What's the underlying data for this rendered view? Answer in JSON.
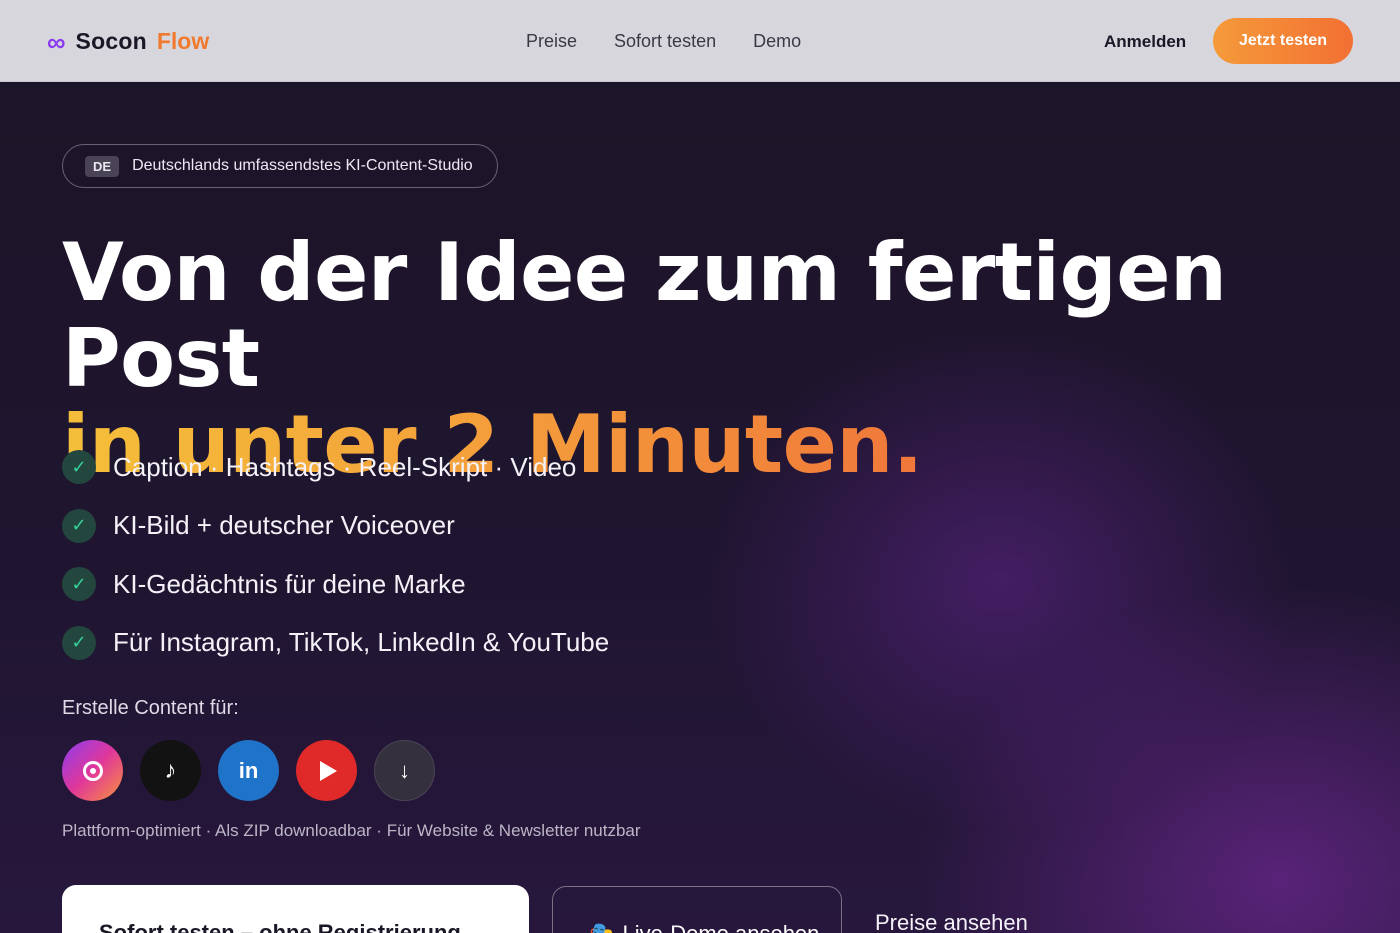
{
  "header": {
    "logo_mark": "∞",
    "logo_part1": "Socon",
    "logo_part2": "Flow",
    "nav": [
      "Preise",
      "Sofort testen",
      "Demo"
    ],
    "login_label": "Anmelden",
    "cta_label": "Jetzt testen"
  },
  "hero": {
    "badge_tag": "DE",
    "badge_text": "Deutschlands umfassendstes KI-Content-Studio",
    "headline_line1": "Von der Idee zum fertigen Post",
    "headline_line2": "in unter 2 Minuten.",
    "features": [
      "Caption · Hashtags · Reel-Skript · Video",
      "KI-Bild + deutscher Voiceover",
      "KI-Gedächtnis für deine Marke",
      "Für Instagram, TikTok, LinkedIn & YouTube"
    ],
    "check_glyph": "✓",
    "platform_label": "Erstelle Content für:",
    "platforms": {
      "tiktok_glyph": "♪",
      "linkedin_text": "in",
      "download_glyph": "↓"
    },
    "platform_note": "Plattform-optimiert · Als ZIP downloadbar · Für Website & Newsletter nutzbar",
    "cta_primary": "Sofort testen – ohne Registrierung →",
    "cta_demo": "🎭 Live-Demo ansehen",
    "cta_price": "Preise ansehen"
  },
  "colors": {
    "accent_orange": "#f27033",
    "accent_yellow": "#f5bf3a",
    "check_green": "#35d39a",
    "logo_purple": "#8a3cf0"
  },
  "icons": [
    "infinity-logo-icon",
    "check-icon",
    "instagram-icon",
    "tiktok-icon",
    "linkedin-icon",
    "youtube-icon",
    "download-icon",
    "theater-masks-icon"
  ]
}
